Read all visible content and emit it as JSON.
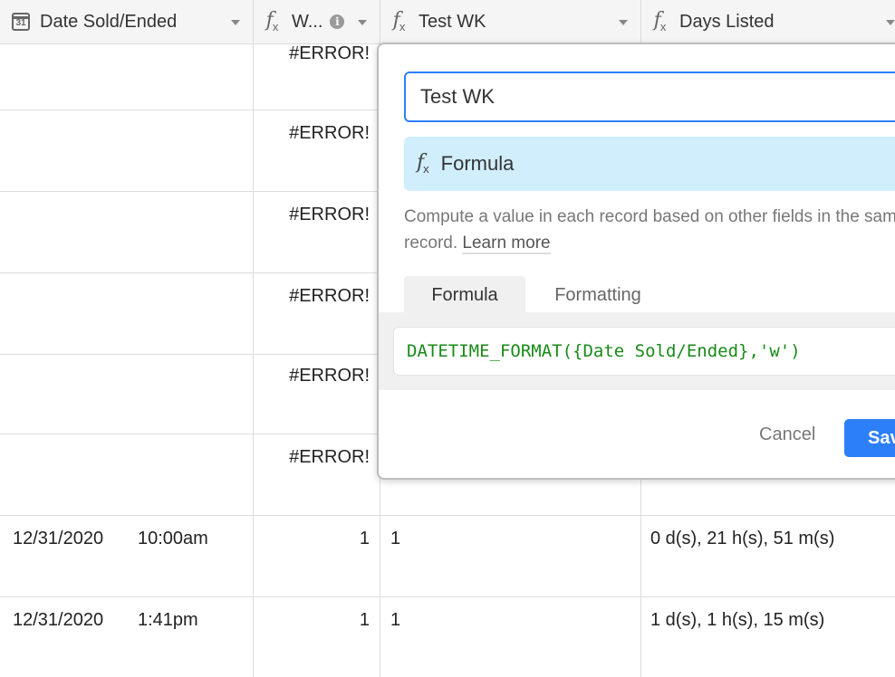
{
  "columns": [
    {
      "label": "Date Sold/Ended",
      "icon": "calendar-icon",
      "icon_text": "31"
    },
    {
      "label": "W...",
      "icon": "formula-icon"
    },
    {
      "label": "Test WK",
      "icon": "formula-icon"
    },
    {
      "label": "Days Listed",
      "icon": "formula-icon"
    }
  ],
  "rows": [
    {
      "date": "",
      "time": "",
      "w": "#ERROR!",
      "test_wk": "",
      "days": ""
    },
    {
      "date": "",
      "time": "",
      "w": "#ERROR!",
      "test_wk": "",
      "days": ""
    },
    {
      "date": "",
      "time": "",
      "w": "#ERROR!",
      "test_wk": "",
      "days": ""
    },
    {
      "date": "",
      "time": "",
      "w": "#ERROR!",
      "test_wk": "",
      "days": ""
    },
    {
      "date": "",
      "time": "",
      "w": "#ERROR!",
      "test_wk": "",
      "days": ""
    },
    {
      "date": "",
      "time": "",
      "w": "#ERROR!",
      "test_wk": "",
      "days": ""
    },
    {
      "date": "12/31/2020",
      "time": "10:00am",
      "w": "1",
      "test_wk": "1",
      "days": "0 d(s), 21 h(s), 51 m(s)"
    },
    {
      "date": "12/31/2020",
      "time": "1:41pm",
      "w": "1",
      "test_wk": "1",
      "days": "1 d(s), 1 h(s), 15 m(s)"
    }
  ],
  "popover": {
    "field_name": "Test WK",
    "field_type": "Formula",
    "description": "Compute a value in each record based on other fields in the same record.",
    "learn_more": "Learn more",
    "tabs": [
      "Formula",
      "Formatting"
    ],
    "formula": "DATETIME_FORMAT({Date Sold/Ended},'w')",
    "cancel_label": "Cancel",
    "save_label": "Save"
  },
  "colors": {
    "accent": "#2d7ff9",
    "type_bg": "#d1eefc",
    "formula_text": "#1a8a1a"
  }
}
